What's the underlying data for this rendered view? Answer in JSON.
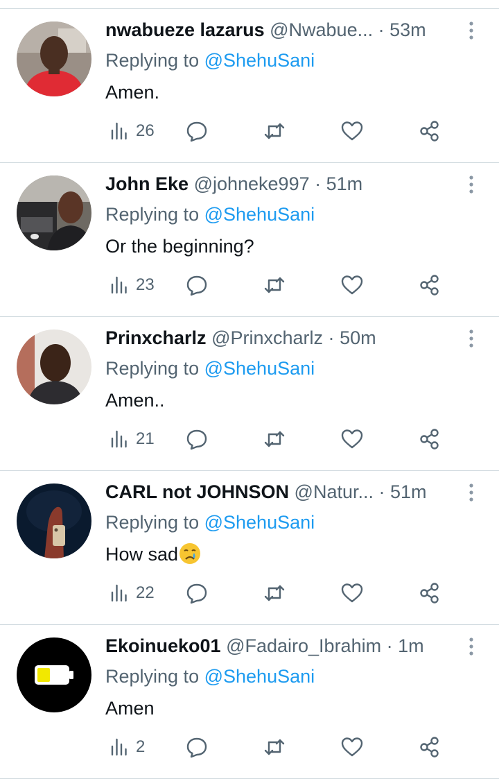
{
  "colors": {
    "text": "#0f1419",
    "secondary": "#536471",
    "link": "#1d9bf0",
    "divider": "#cfd9de"
  },
  "replies": [
    {
      "name": "nwabueze lazarus",
      "handle": "@Nwabue...",
      "time": "53m",
      "replying_to": "Replying to",
      "mention": "@ShehuSani",
      "text": "Amen.",
      "views": "26",
      "avatar": "photo of man in red shirt"
    },
    {
      "name": "John Eke",
      "handle": "@johneke997",
      "time": "51m",
      "replying_to": "Replying to",
      "mention": "@ShehuSani",
      "text": "Or the beginning?",
      "views": "23",
      "avatar": "photo of man beside car"
    },
    {
      "name": "Prinxcharlz",
      "handle": "@Prinxcharlz",
      "time": "50m",
      "replying_to": "Replying to",
      "mention": "@ShehuSani",
      "text": "Amen..",
      "views": "21",
      "avatar": "photo of man"
    },
    {
      "name": "CARL not JOHNSON",
      "handle": "@Natur...",
      "time": "51m",
      "replying_to": "Replying to",
      "mention": "@ShehuSani",
      "text": "How sad",
      "emoji": "crying-face",
      "views": "22",
      "avatar": "photo of hand holding phone"
    },
    {
      "name": "Ekoinueko01",
      "handle": "@Fadairo_Ibrahim",
      "time": "1m",
      "replying_to": "Replying to",
      "mention": "@ShehuSani",
      "text": "Amen",
      "views": "2",
      "avatar": "low battery icon on black"
    }
  ],
  "icons": [
    "views-icon",
    "reply-icon",
    "retweet-icon",
    "like-icon",
    "share-icon",
    "more-options-icon"
  ]
}
